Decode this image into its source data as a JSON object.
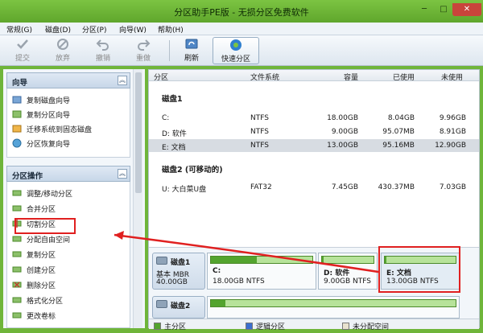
{
  "window": {
    "title": "分区助手PE版 - 无损分区免费软件",
    "minimize": "─",
    "maximize": "□",
    "close": "✕"
  },
  "menu": [
    "常规(G)",
    "磁盘(D)",
    "分区(P)",
    "向导(W)",
    "帮助(H)"
  ],
  "toolbar": {
    "submit": "提交",
    "discard": "放弃",
    "undo": "撤销",
    "redo": "重做",
    "refresh": "刷新",
    "quick_partition": "快速分区"
  },
  "sidebar": {
    "wizard_title": "向导",
    "wizard_items": [
      "复制磁盘向导",
      "复制分区向导",
      "迁移系统到固态磁盘",
      "分区恢复向导"
    ],
    "ops_title": "分区操作",
    "ops_items": [
      "调整/移动分区",
      "合并分区",
      "切割分区",
      "分配自由空间",
      "复制分区",
      "创建分区",
      "删除分区",
      "格式化分区",
      "更改卷标"
    ]
  },
  "table": {
    "headers": [
      "分区",
      "文件系统",
      "容量",
      "已使用",
      "未使用"
    ],
    "disk1_label": "磁盘1",
    "disk1_rows": [
      {
        "name": "C:",
        "fs": "NTFS",
        "capacity": "18.00GB",
        "used": "8.04GB",
        "free": "9.96GB"
      },
      {
        "name": "D: 软件",
        "fs": "NTFS",
        "capacity": "9.00GB",
        "used": "95.07MB",
        "free": "8.91GB"
      },
      {
        "name": "E: 文档",
        "fs": "NTFS",
        "capacity": "13.00GB",
        "used": "95.16MB",
        "free": "12.90GB"
      }
    ],
    "disk2_label": "磁盘2 (可移动的)",
    "disk2_rows": [
      {
        "name": "U: 大白菜U盘",
        "fs": "FAT32",
        "capacity": "7.45GB",
        "used": "430.37MB",
        "free": "7.03GB"
      }
    ]
  },
  "disk_map": {
    "disk1": {
      "name": "磁盘1",
      "type": "基本 MBR",
      "size": "40.00GB"
    },
    "disk1_parts": [
      {
        "name": "C:",
        "info": "18.00GB NTFS",
        "used_fraction": 0.45
      },
      {
        "name": "D: 软件",
        "info": "9.00GB NTFS",
        "used_fraction": 0.02
      },
      {
        "name": "E: 文档",
        "info": "13.00GB NTFS",
        "used_fraction": 0.02
      }
    ],
    "disk2": {
      "name": "磁盘2"
    }
  },
  "legend": {
    "primary": "主分区",
    "logical": "逻辑分区",
    "unallocated": "未分配空间"
  },
  "colors": {
    "accent_green": "#6fb53a",
    "primary_partition": "#53a42e",
    "logical_partition": "#3b6fcf",
    "unallocated": "#e8e2cf",
    "annotation_red": "#e02020"
  }
}
